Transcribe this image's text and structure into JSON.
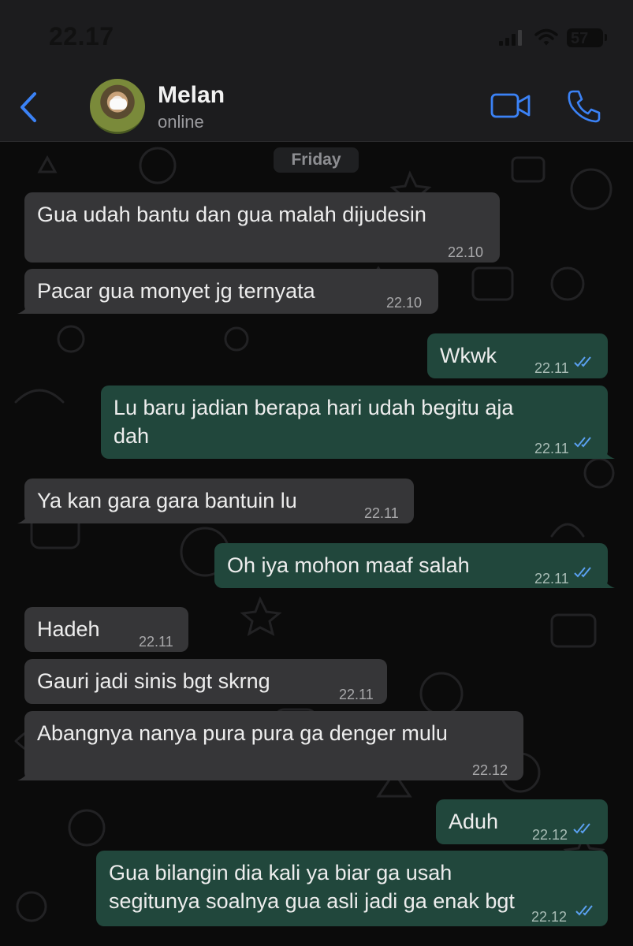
{
  "status_bar": {
    "time": "22.17",
    "battery": "57"
  },
  "header": {
    "contact_name": "Melan",
    "contact_status": "online"
  },
  "chat": {
    "date_label": "Friday",
    "messages": [
      {
        "direction": "in",
        "text": "Gua udah bantu dan gua malah dijudesin",
        "time": "22.10"
      },
      {
        "direction": "in",
        "text": "Pacar gua monyet jg ternyata",
        "time": "22.10"
      },
      {
        "direction": "out",
        "text": "Wkwk",
        "time": "22.11",
        "status": "read"
      },
      {
        "direction": "out",
        "text_line1": "Lu baru jadian berapa hari udah begitu aja",
        "text_line2": "dah",
        "time": "22.11",
        "status": "read"
      },
      {
        "direction": "in",
        "text": "Ya kan gara gara bantuin lu",
        "time": "22.11"
      },
      {
        "direction": "out",
        "text": "Oh iya mohon maaf salah",
        "time": "22.11",
        "status": "read"
      },
      {
        "direction": "in",
        "text": "Hadeh",
        "time": "22.11"
      },
      {
        "direction": "in",
        "text": "Gauri jadi sinis bgt skrng",
        "time": "22.11"
      },
      {
        "direction": "in",
        "text": "Abangnya nanya pura pura ga denger mulu",
        "time": "22.12"
      },
      {
        "direction": "out",
        "text": "Aduh",
        "time": "22.12",
        "status": "read"
      },
      {
        "direction": "out",
        "text_line1": "Gua bilangin dia kali ya biar ga usah",
        "text_line2": "segitunya soalnya gua asli jadi ga enak bgt",
        "time": "22.12",
        "status": "read"
      }
    ]
  },
  "colors": {
    "incoming_bubble": "#363638",
    "outgoing_bubble": "#21473c",
    "accent_blue": "#3b82f6",
    "read_ticks": "#5aa0f0"
  },
  "icons": {
    "back": "chevron-left-icon",
    "video_call": "video-camera-icon",
    "voice_call": "phone-icon",
    "read_receipt": "double-check-icon"
  }
}
